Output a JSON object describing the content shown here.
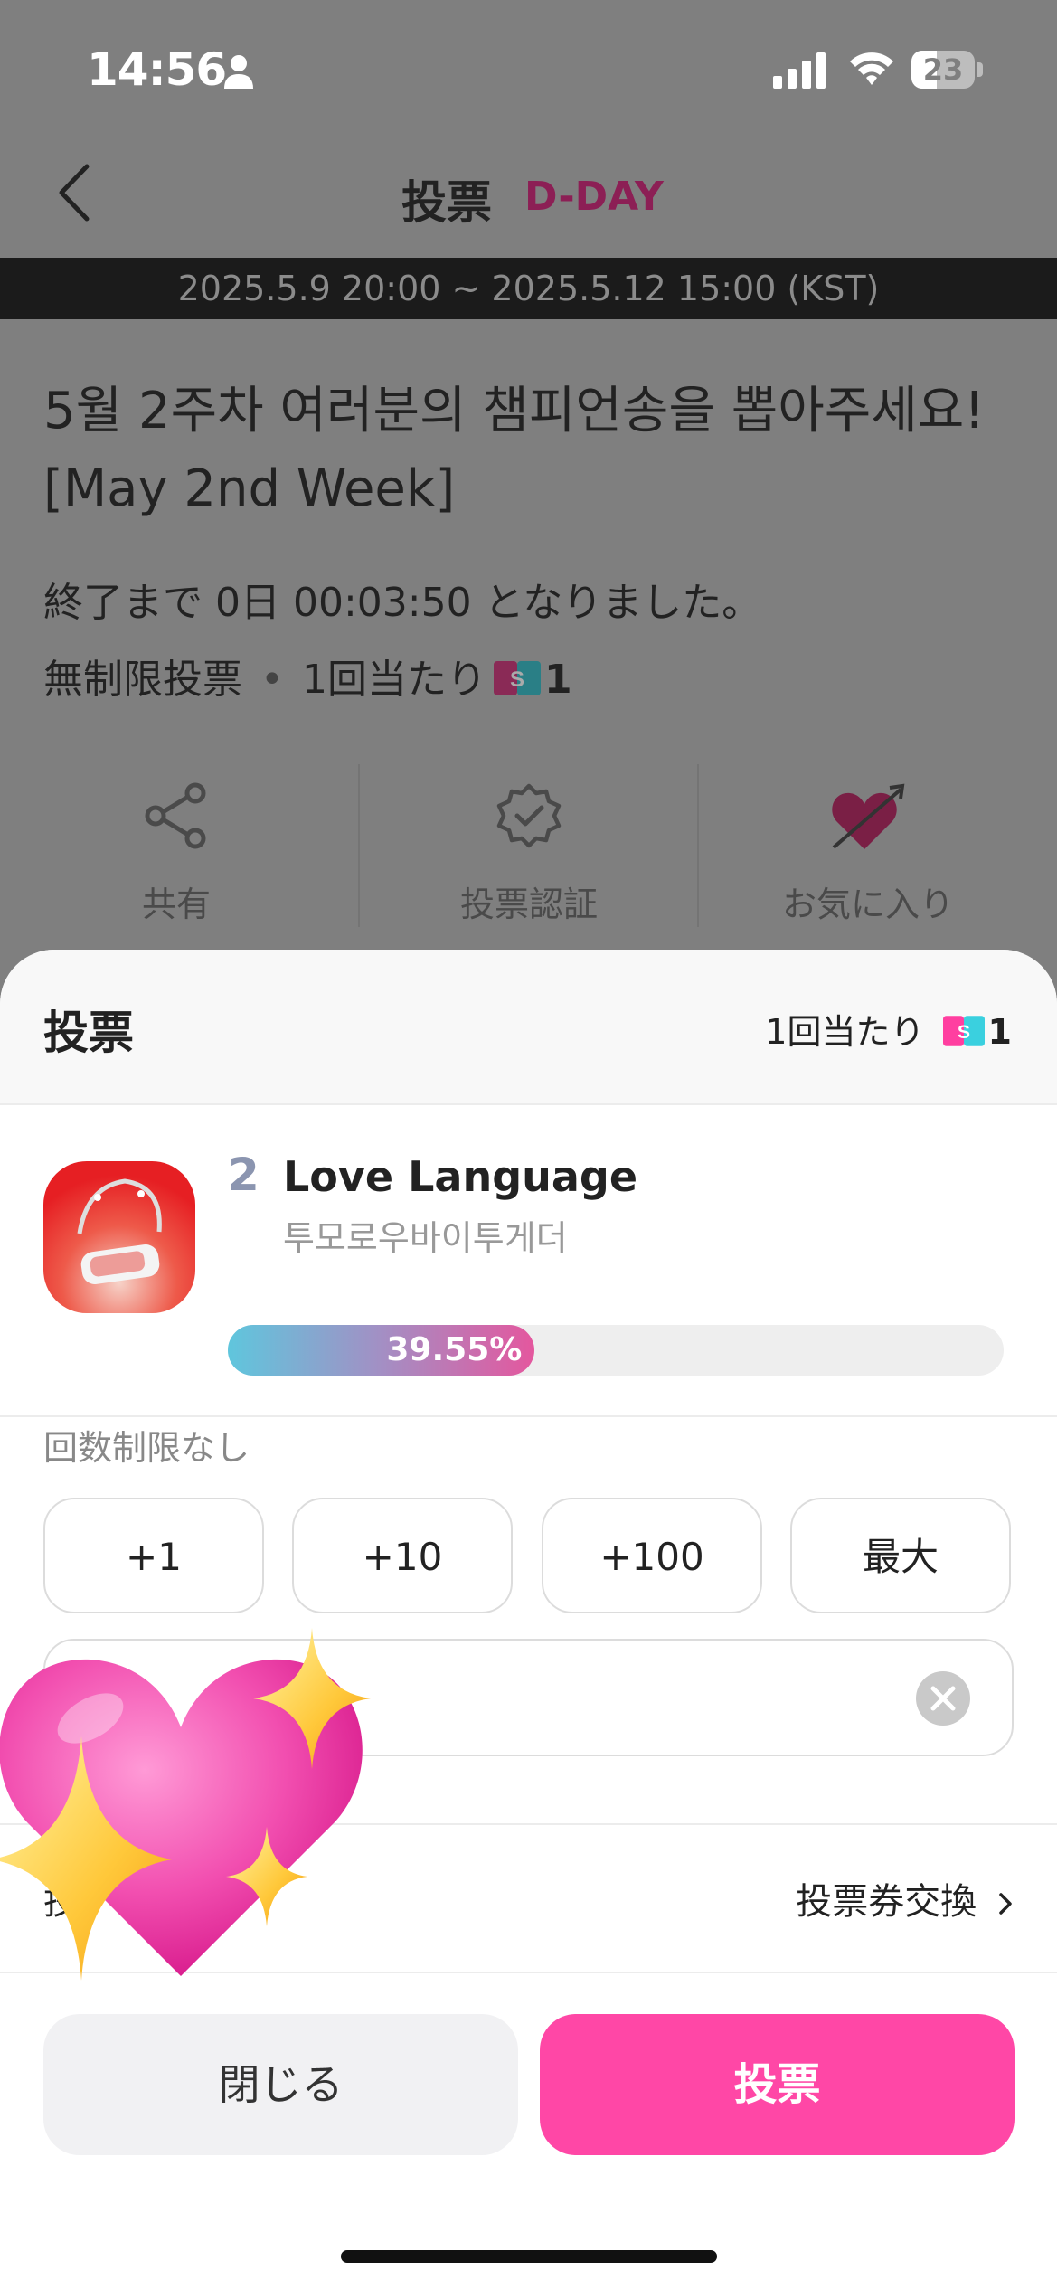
{
  "status_bar": {
    "time": "14:56",
    "battery": "23"
  },
  "nav": {
    "title": "投票",
    "badge": "D-DAY"
  },
  "period": "2025.5.9 20:00 ~ 2025.5.12 15:00 (KST)",
  "vote": {
    "title_line1": "5월 2주차 여러분의 챔피언송을 뽑아주세요!",
    "title_line2": "[May 2nd Week]",
    "end_text": "終了まで 0日 00:03:50 となりました。",
    "type": "無制限投票",
    "cost_label": "1回当たり",
    "cost": "1"
  },
  "actions": [
    {
      "label": "共有",
      "icon": "share-icon"
    },
    {
      "label": "投票認証",
      "icon": "verified-badge-icon"
    },
    {
      "label": "お気に入り",
      "icon": "heart-arrow-icon"
    }
  ],
  "sheet": {
    "title": "投票",
    "per_vote_label": "1回当たり",
    "per_vote_cost": "1",
    "song": {
      "rank": "2",
      "title": "Love Language",
      "artist": "투모로우바이투게더",
      "percent": 39.55,
      "percent_label": "39.55%"
    },
    "limit_label": "回数制限なし",
    "quantity_buttons": [
      "+1",
      "+10",
      "+100",
      "最大"
    ],
    "exchange_label": "投票券交換",
    "owned_label_visible": "投",
    "close_label": "閉じる",
    "vote_label": "投票"
  },
  "colors": {
    "accent": "#ff47a6",
    "dday": "#8c1f55",
    "rank": "#8b95b0"
  }
}
